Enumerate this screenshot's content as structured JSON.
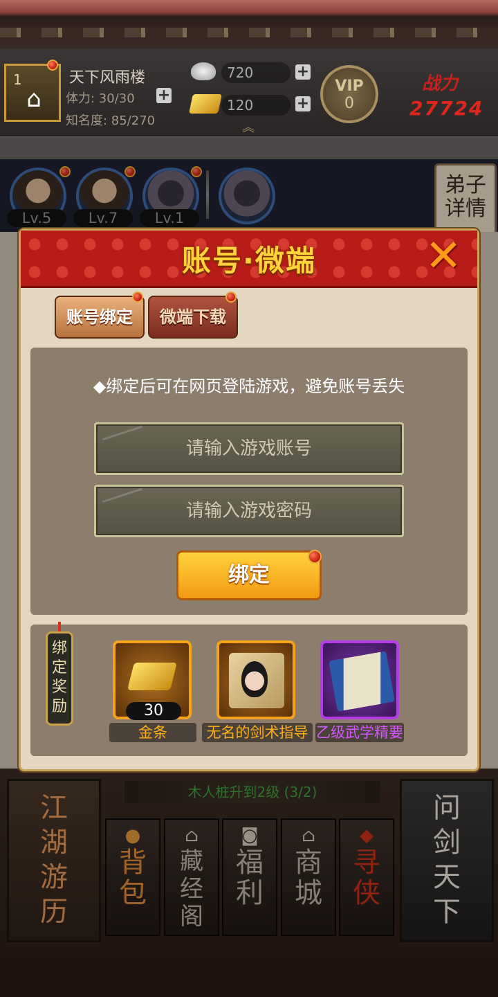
{
  "header": {
    "sect_rank": "1",
    "sect_name": "天下风雨楼",
    "stamina_label": "体力: 30/30",
    "fame_label": "知名度: 85/270",
    "silver": "720",
    "gold": "120",
    "vip_label": "VIP",
    "vip_level": "0",
    "power_label": "战力",
    "power_value": "27724"
  },
  "disciples": [
    {
      "level": "Lv.5"
    },
    {
      "level": "Lv.7"
    },
    {
      "level": "Lv.1"
    }
  ],
  "detail_button": "弟子\n详情",
  "modal": {
    "title": "账号·微端",
    "tabs": [
      {
        "label": "账号绑定",
        "active": true
      },
      {
        "label": "微端下载",
        "active": false
      }
    ],
    "notice": "◆绑定后可在网页登陆游戏，避免账号丢失",
    "account_placeholder": "请输入游戏账号",
    "password_placeholder": "请输入游戏密码",
    "bind_button": "绑定",
    "reward_tag": "绑定奖励",
    "rewards": [
      {
        "name": "金条",
        "count": "30",
        "rarity": "gold",
        "icon": "gold-bar-icon"
      },
      {
        "name": "无名的剑术指导",
        "count": "",
        "rarity": "gold",
        "icon": "scroll-portrait-icon"
      },
      {
        "name": "乙级武学精要",
        "count": "",
        "rarity": "purple",
        "icon": "manual-book-icon"
      }
    ]
  },
  "background": {
    "quest_text": "木人桩升到2级 (3/2)",
    "left_card": "江湖游历",
    "right_card": "问剑天下",
    "nav": [
      {
        "label": "背包",
        "icon": "bag-icon"
      },
      {
        "label": "藏经阁",
        "icon": "pavilion-icon"
      },
      {
        "label": "福利",
        "icon": "coin-icon"
      },
      {
        "label": "商城",
        "icon": "shop-icon"
      },
      {
        "label": "寻侠",
        "icon": "seal-icon"
      }
    ]
  },
  "colors": {
    "modal_header_red": "#b71c18",
    "title_gold": "#ffd43b",
    "bind_orange": "#f29a12",
    "rarity_gold": "#ffae1a",
    "rarity_purple": "#d257ff",
    "notify_dot": "#c0180c"
  }
}
